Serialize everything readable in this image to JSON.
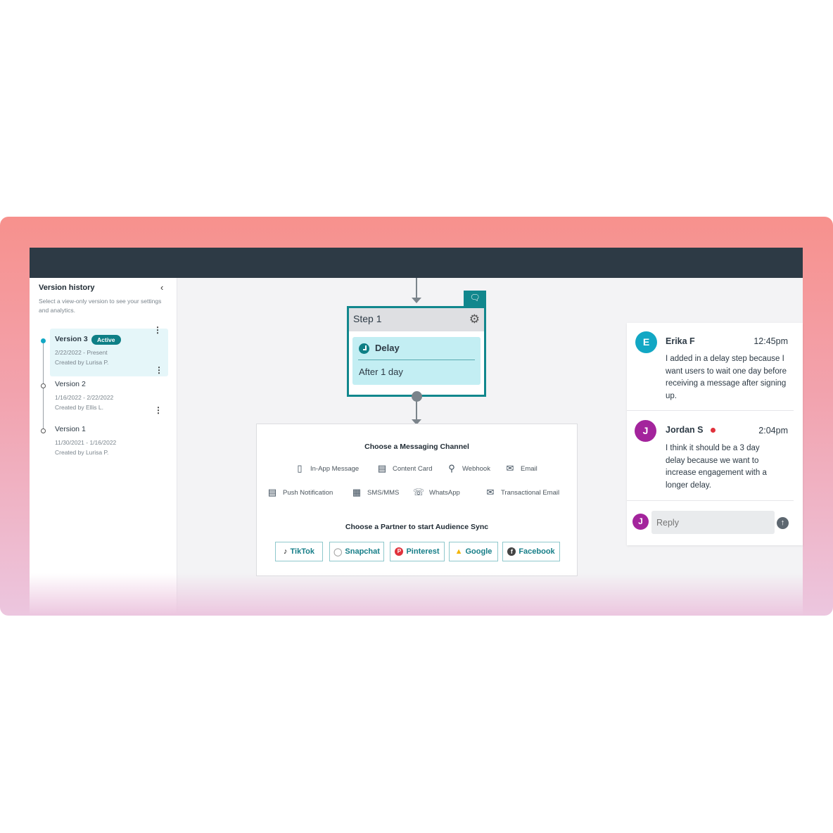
{
  "colors": {
    "accent": "#0e7f86",
    "topbar": "#2d3a45",
    "erika_avatar": "#12a7c4",
    "jordan_avatar": "#a3249c",
    "unread_dot": "#e0323c"
  },
  "sidebar": {
    "title": "Version history",
    "subtitle": "Select a view-only version to see your settings and analytics.",
    "collapse_icon": "chevron-left-icon",
    "versions": [
      {
        "name": "Version 3",
        "badge": "Active",
        "dates": "2/22/2022 - Present",
        "created_by": "Created by Lurisa P."
      },
      {
        "name": "Version 2",
        "dates": "1/16/2022 - 2/22/2022",
        "created_by": "Created by Ellis L."
      },
      {
        "name": "Version 1",
        "dates": "11/30/2021 - 1/16/2022",
        "created_by": "Created by Lurisa P."
      }
    ]
  },
  "step": {
    "title": "Step 1",
    "type": "Delay",
    "detail": "After 1 day"
  },
  "channels": {
    "title": "Choose a Messaging Channel",
    "items": [
      "In-App Message",
      "Content Card",
      "Webhook",
      "Email",
      "Push Notification",
      "SMS/MMS",
      "WhatsApp",
      "Transactional Email"
    ]
  },
  "partners": {
    "title": "Choose a Partner to start Audience Sync",
    "items": [
      "TikTok",
      "Snapchat",
      "Pinterest",
      "Google",
      "Facebook"
    ]
  },
  "comments": [
    {
      "initial": "E",
      "name": "Erika F",
      "time": "12:45pm",
      "text": "I added in a delay step because I want users to wait one day before receiving a message after signing up."
    },
    {
      "initial": "J",
      "name": "Jordan S",
      "time": "2:04pm",
      "text": "I think it should be a 3 day delay because we want to increase engagement with a longer delay."
    }
  ],
  "reply": {
    "initial": "J",
    "placeholder": "Reply"
  }
}
